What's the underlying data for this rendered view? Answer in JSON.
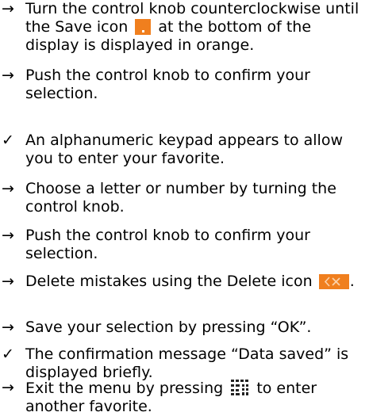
{
  "document": {
    "colors": {
      "accent": "#f07f1e",
      "text": "#000000",
      "background": "#ffffff"
    },
    "items": [
      {
        "marker": "→",
        "text_parts": [
          "Turn the control knob counterclockwise until the Save icon ",
          " at the bottom of the display is displayed in orange."
        ],
        "icon": "save-icon"
      },
      {
        "marker": "→",
        "text": "Push the control knob to confirm your selection."
      },
      {
        "marker": "✓",
        "text": "An alphanumeric keypad appears to allow you to enter your favorite."
      },
      {
        "marker": "→",
        "text": "Choose a letter or number by turning the control knob."
      },
      {
        "marker": "→",
        "text": "Push the control knob to confirm your selection."
      },
      {
        "marker": "→",
        "text_parts": [
          "Delete mistakes using the Delete icon ",
          "."
        ],
        "icon": "delete-icon"
      },
      {
        "marker": "→",
        "text": "Save your selection by pressing “OK”."
      },
      {
        "marker": "✓",
        "text": "The confirmation message “Data saved” is displayed briefly."
      },
      {
        "marker": "→",
        "text_parts": [
          "Exit the menu by pressing ",
          " to enter another favorite."
        ],
        "icon": "menu-icon"
      }
    ]
  }
}
